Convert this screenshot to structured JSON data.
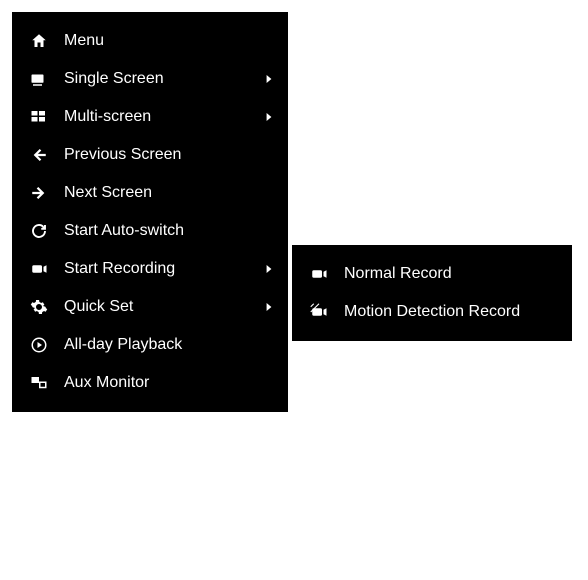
{
  "main_menu": {
    "items": [
      {
        "label": "Menu"
      },
      {
        "label": "Single Screen"
      },
      {
        "label": "Multi-screen"
      },
      {
        "label": "Previous Screen"
      },
      {
        "label": "Next Screen"
      },
      {
        "label": "Start Auto-switch"
      },
      {
        "label": "Start Recording"
      },
      {
        "label": "Quick Set"
      },
      {
        "label": "All-day Playback"
      },
      {
        "label": "Aux Monitor"
      }
    ]
  },
  "sub_menu": {
    "items": [
      {
        "label": "Normal Record"
      },
      {
        "label": "Motion Detection Record"
      }
    ]
  }
}
